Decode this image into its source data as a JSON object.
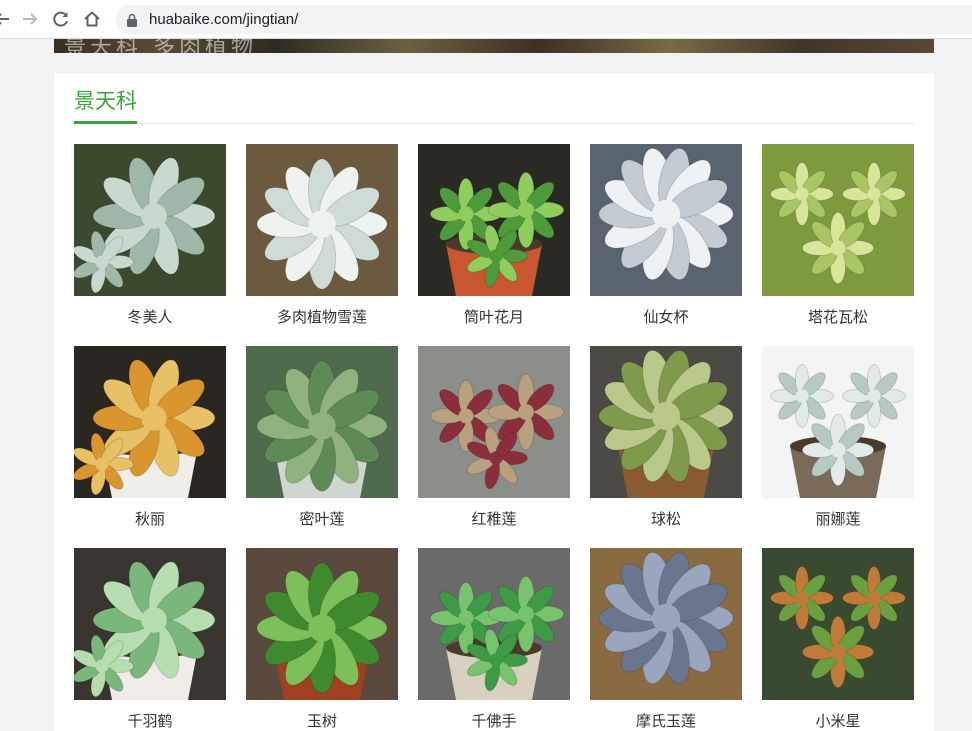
{
  "browser": {
    "url": "huabaike.com/jingtian/"
  },
  "banner": {
    "text": "景天科 多肉植物"
  },
  "section": {
    "title": "景天科"
  },
  "accent_color": "#3ba53b",
  "plants": [
    {
      "name": "冬美人",
      "bg": "#3b4a2e",
      "leaf": "#9fb8a8",
      "leaf2": "#c9d9cf",
      "pot": ""
    },
    {
      "name": "多肉植物雪莲",
      "bg": "#6b5a3e",
      "leaf": "#cfdcd6",
      "leaf2": "#eef3f0",
      "pot": ""
    },
    {
      "name": "筒叶花月",
      "bg": "#2a2a24",
      "leaf": "#4f9a3a",
      "leaf2": "#8fce5c",
      "pot": "#c8562e"
    },
    {
      "name": "仙女杯",
      "bg": "#5a6470",
      "leaf": "#c3ccd3",
      "leaf2": "#eef2f5",
      "pot": ""
    },
    {
      "name": "塔花瓦松",
      "bg": "#7f9a3e",
      "leaf": "#a9c564",
      "leaf2": "#d7e69a",
      "pot": ""
    },
    {
      "name": "秋丽",
      "bg": "#2a2722",
      "leaf": "#d9962f",
      "leaf2": "#e8c065",
      "pot": "#f0eeea"
    },
    {
      "name": "密叶莲",
      "bg": "#4f6a4d",
      "leaf": "#5e8a55",
      "leaf2": "#8fb27e",
      "pot": "#cfd6cf"
    },
    {
      "name": "红稚莲",
      "bg": "#8c8e8a",
      "leaf": "#8a2e3c",
      "leaf2": "#b9a07e",
      "pot": ""
    },
    {
      "name": "球松",
      "bg": "#4b4a45",
      "leaf": "#7f9a4a",
      "leaf2": "#b8c98a",
      "pot": "#8a5a30"
    },
    {
      "name": "丽娜莲",
      "bg": "#f4f4f4",
      "leaf": "#b7c9c3",
      "leaf2": "#e2ebe7",
      "pot": "#7a6a5a"
    },
    {
      "name": "千羽鹤",
      "bg": "#3a3430",
      "leaf": "#7ab77a",
      "leaf2": "#b6deb0",
      "pot": "#f1ecea"
    },
    {
      "name": "玉树",
      "bg": "#5a4a3e",
      "leaf": "#3f8a2f",
      "leaf2": "#7dc05a",
      "pot": "#a04020"
    },
    {
      "name": "千佛手",
      "bg": "#6a6a6a",
      "leaf": "#3f9a45",
      "leaf2": "#78c46e",
      "pot": "#d8d0c0"
    },
    {
      "name": "摩氏玉莲",
      "bg": "#8a6a40",
      "leaf": "#6a7690",
      "leaf2": "#9aa6bf",
      "pot": ""
    },
    {
      "name": "小米星",
      "bg": "#3a4a30",
      "leaf": "#6aa040",
      "leaf2": "#c07a3a",
      "pot": ""
    }
  ]
}
